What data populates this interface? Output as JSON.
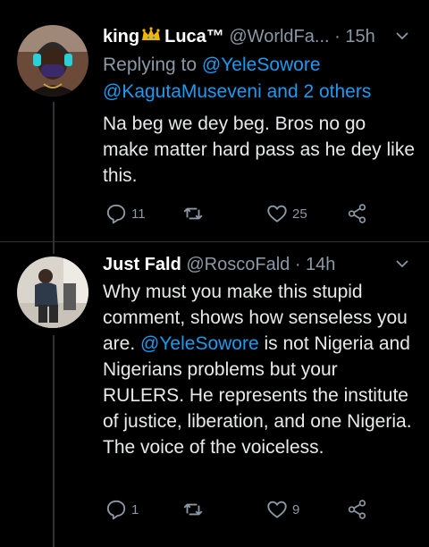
{
  "tweets": [
    {
      "name": "king",
      "name2": "Luca™",
      "handle": "@WorldFa...",
      "time": "· 15h",
      "replying_prefix": "Replying to ",
      "replying_to_1": "@YeleSowore",
      "replying_to_2": "@KagutaMuseveni and 2 others",
      "text": "Na beg we dey beg. Bros no go make matter hard pass as he dey like this.",
      "replies": "11",
      "retweets": "",
      "likes": "25"
    },
    {
      "name": "Just Fald",
      "handle": "@RoscoFald",
      "time": "· 14h",
      "text_1": "Why must you make this stupid comment, shows how senseless you are. ",
      "mention": "@YeleSowore",
      "text_2": " is not Nigeria and Nigerians problems but your RULERS. He represents the institute of justice, liberation, and one Nigeria. The voice of the voiceless.",
      "replies": "1",
      "retweets": "",
      "likes": "9"
    }
  ],
  "colors": {
    "background": "#000000",
    "link": "#1d9bf0",
    "muted": "#8b98a5",
    "text": "#e7e9ea"
  },
  "icons": [
    "chevron-down-icon",
    "crown-icon",
    "reply-icon",
    "retweet-icon",
    "like-icon",
    "share-icon"
  ]
}
